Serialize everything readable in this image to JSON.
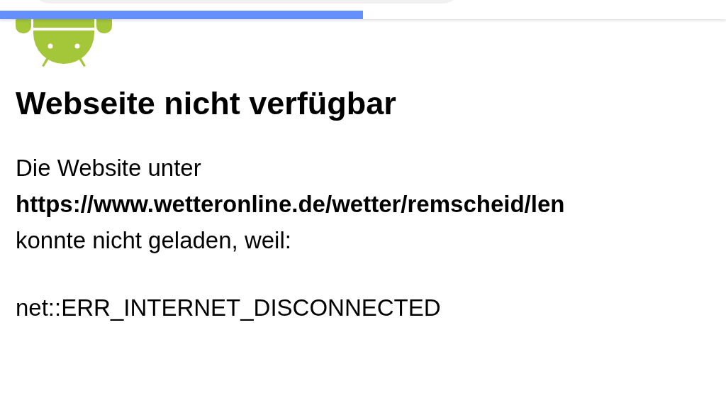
{
  "toolbar": {
    "progress": {
      "level": 0.5
    }
  },
  "error_page": {
    "title": "Webseite nicht verfügbar",
    "message_lines": [
      "Die Website unter",
      "https://www.wetteronline.de/wetter/remscheid/len",
      "konnte nicht geladen, weil:"
    ],
    "error_code": "net::ERR_INTERNET_DISCONNECTED"
  }
}
